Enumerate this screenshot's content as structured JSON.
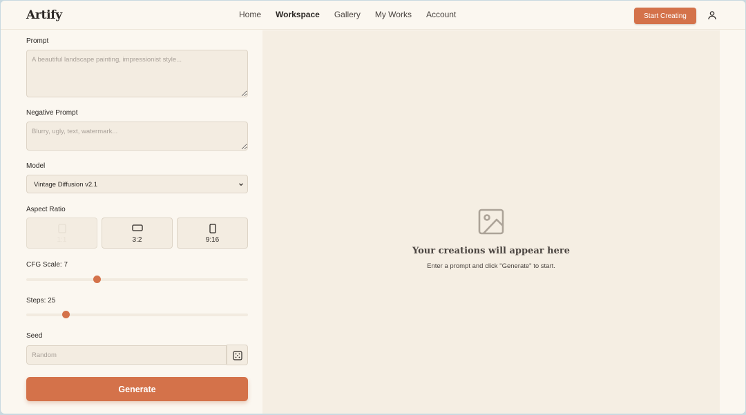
{
  "header": {
    "logo": "Artify",
    "nav": [
      {
        "label": "Home",
        "active": false
      },
      {
        "label": "Workspace",
        "active": true
      },
      {
        "label": "Gallery",
        "active": false
      },
      {
        "label": "My Works",
        "active": false
      },
      {
        "label": "Account",
        "active": false
      }
    ],
    "cta_label": "Start Creating",
    "user_icon": "user-icon"
  },
  "form": {
    "prompt": {
      "label": "Prompt",
      "placeholder": "A beautiful landscape painting, impressionist style...",
      "value": ""
    },
    "negative_prompt": {
      "label": "Negative Prompt",
      "placeholder": "Blurry, ugly, text, watermark...",
      "value": ""
    },
    "model": {
      "label": "Model",
      "selected": "Vintage Diffusion v2.1"
    },
    "aspect_ratio": {
      "label": "Aspect Ratio",
      "options": [
        "1:1",
        "3:2",
        "9:16"
      ],
      "selected": "1:1"
    },
    "cfg_scale": {
      "label": "CFG Scale: 7",
      "value": 7,
      "fraction": 0.32
    },
    "steps": {
      "label": "Steps: 25",
      "value": 25,
      "fraction": 0.18
    },
    "seed": {
      "label": "Seed",
      "placeholder": "Random",
      "value": "",
      "dice_icon": "dice-icon"
    },
    "generate_label": "Generate"
  },
  "preview": {
    "icon": "image-icon",
    "title": "Your creations will appear here",
    "subtitle": "Enter a prompt and click \"Generate\" to start."
  },
  "colors": {
    "accent": "#d4724a",
    "background": "#fbf7f0",
    "preview_bg": "#f5eee3",
    "input_bg": "#f3ece1"
  }
}
